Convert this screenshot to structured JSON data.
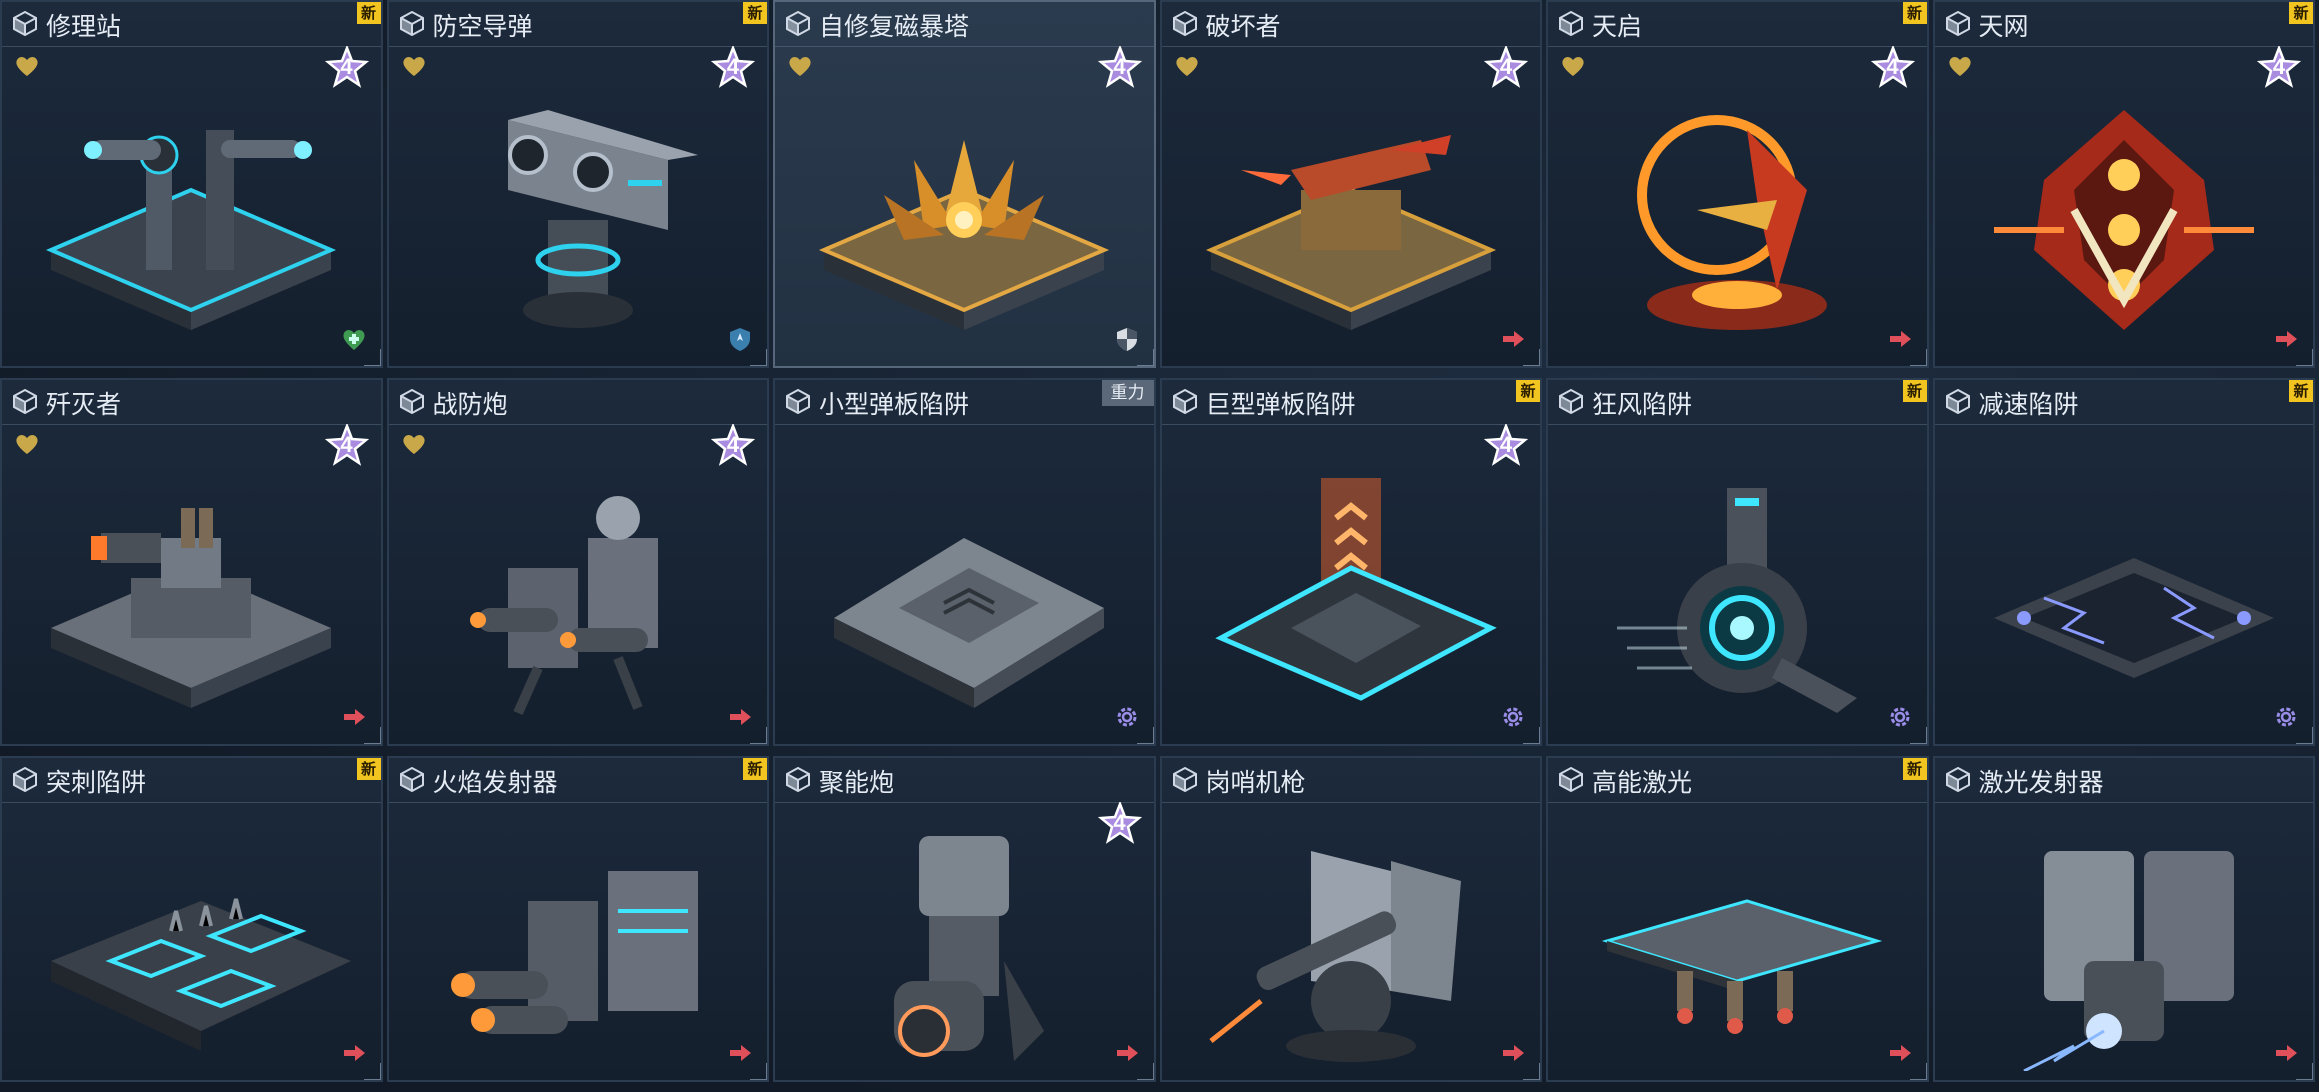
{
  "colors": {
    "accent_cyan": "#3ee6ff",
    "new_badge": "#f2c420",
    "heart": "#c9a84a",
    "star": "#a98be0",
    "arrow": "#e0505a",
    "gear": "#9a8de8"
  },
  "cards": [
    {
      "name": "修理站",
      "badge": "新",
      "heart": true,
      "star": "4",
      "tag": "heal-cross-icon",
      "art": "repair"
    },
    {
      "name": "防空导弹",
      "badge": "新",
      "heart": true,
      "star": "4",
      "tag": "shield-plane-icon",
      "art": "aa"
    },
    {
      "name": "自修复磁暴塔",
      "badge": "",
      "heart": true,
      "star": "4",
      "tag": "shield-icon",
      "art": "tesla",
      "selected": true
    },
    {
      "name": "破坏者",
      "badge": "",
      "heart": true,
      "star": "4",
      "tag": "arrow-icon",
      "art": "gold"
    },
    {
      "name": "天启",
      "badge": "新",
      "heart": true,
      "star": "4",
      "tag": "arrow-icon",
      "art": "ring"
    },
    {
      "name": "天网",
      "badge": "新",
      "heart": true,
      "star": "4",
      "tag": "arrow-icon",
      "art": "red"
    },
    {
      "name": "歼灭者",
      "badge": "",
      "heart": true,
      "star": "4",
      "tag": "arrow-icon",
      "art": "tank"
    },
    {
      "name": "战防炮",
      "badge": "",
      "heart": true,
      "star": "4",
      "tag": "arrow-icon",
      "art": "guns"
    },
    {
      "name": "小型弹板陷阱",
      "badge": "重力",
      "heart": false,
      "star": "",
      "tag": "gear-icon",
      "art": "plate"
    },
    {
      "name": "巨型弹板陷阱",
      "badge": "新",
      "heart": false,
      "star": "4",
      "tag": "gear-icon",
      "art": "bigplate"
    },
    {
      "name": "狂风陷阱",
      "badge": "新",
      "heart": false,
      "star": "",
      "tag": "gear-icon",
      "art": "fan"
    },
    {
      "name": "减速陷阱",
      "badge": "新",
      "heart": false,
      "star": "",
      "tag": "gear-icon",
      "art": "slow"
    },
    {
      "name": "突刺陷阱",
      "badge": "新",
      "heart": false,
      "star": "",
      "tag": "arrow-icon",
      "art": "spike"
    },
    {
      "name": "火焰发射器",
      "badge": "新",
      "heart": false,
      "star": "",
      "tag": "arrow-icon",
      "art": "flame"
    },
    {
      "name": "聚能炮",
      "badge": "",
      "heart": false,
      "star": "4",
      "tag": "arrow-icon",
      "art": "cannon"
    },
    {
      "name": "岗哨机枪",
      "badge": "",
      "heart": false,
      "star": "",
      "tag": "arrow-icon",
      "art": "sentry"
    },
    {
      "name": "高能激光",
      "badge": "新",
      "heart": false,
      "star": "",
      "tag": "arrow-icon",
      "art": "laser"
    },
    {
      "name": "激光发射器",
      "badge": "",
      "heart": false,
      "star": "",
      "tag": "arrow-icon",
      "art": "emitter"
    }
  ]
}
